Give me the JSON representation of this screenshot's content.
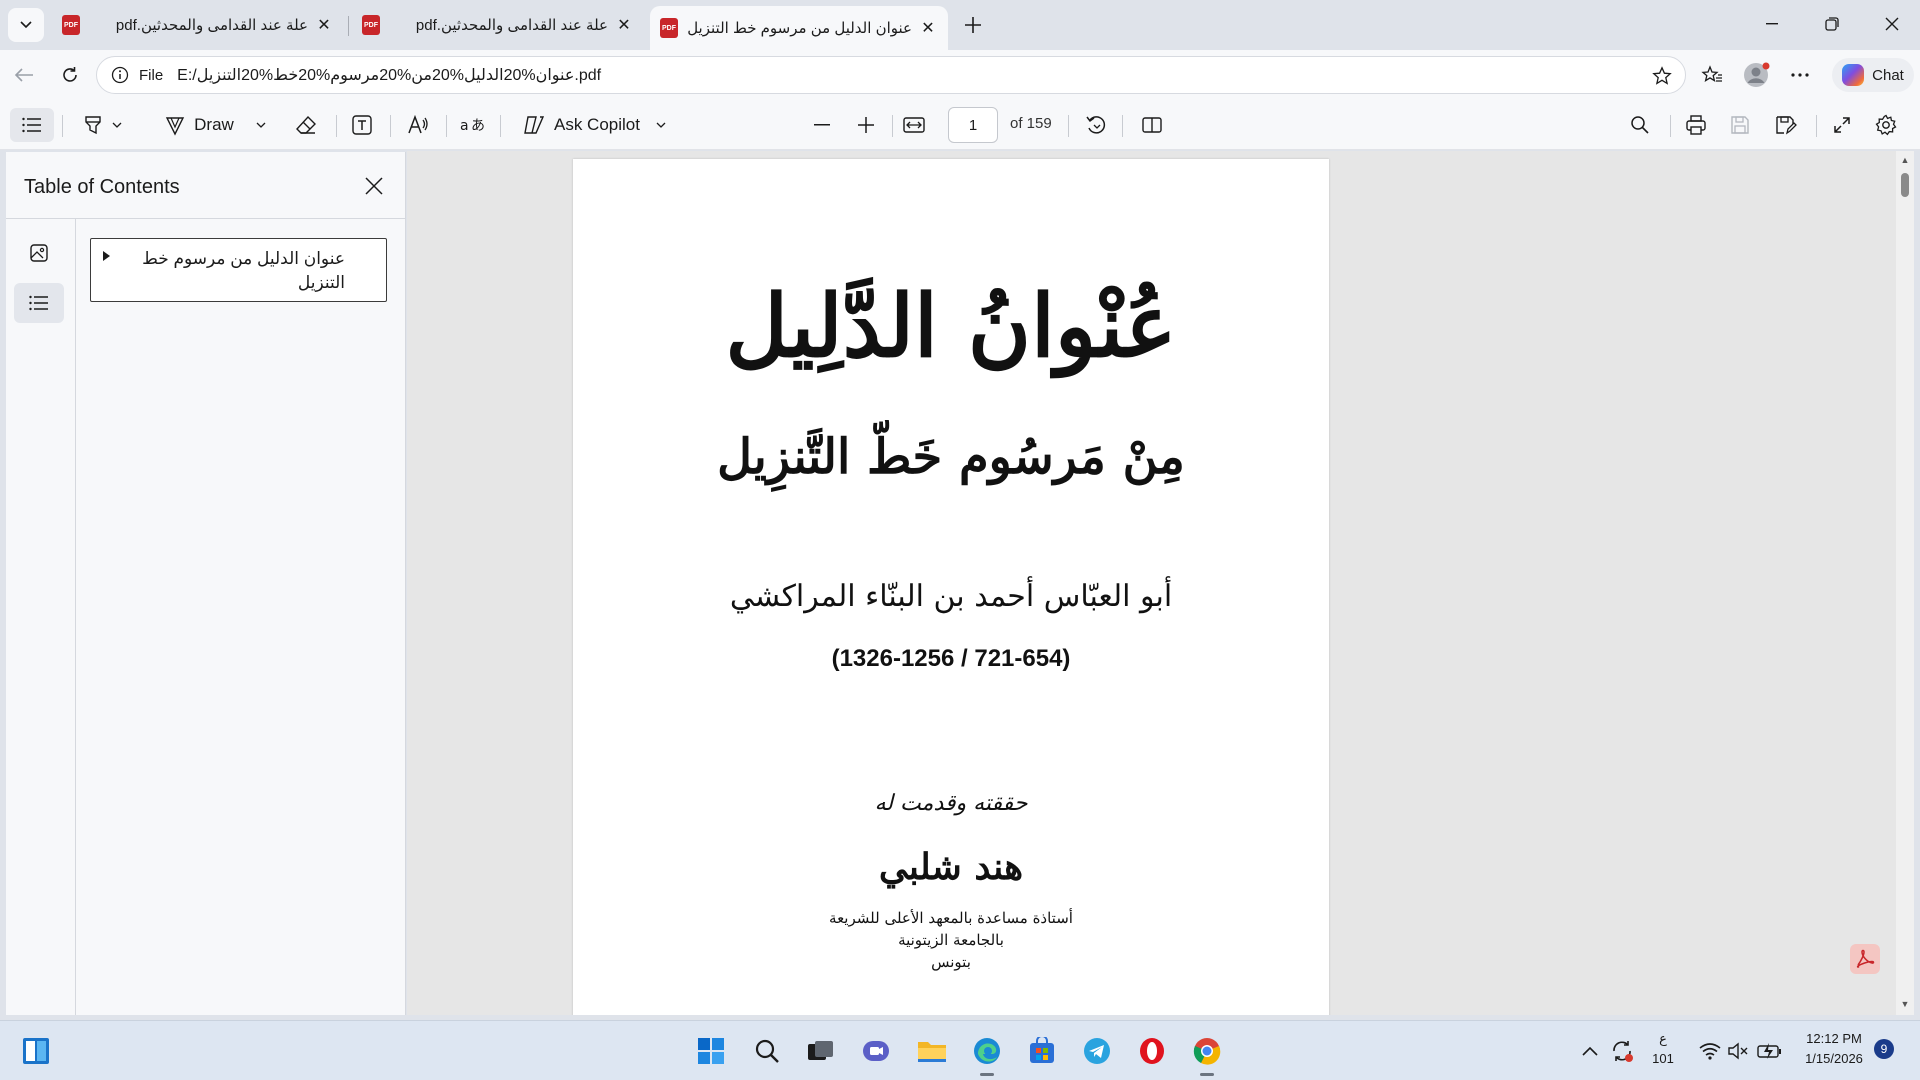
{
  "tabs": [
    {
      "label": "علة عند القدامى والمحدثين.pdf",
      "icon": "pdf-icon",
      "close": "✕",
      "active": false
    },
    {
      "label": "علة عند القدامى والمحدثين.pdf",
      "icon": "pdf-icon",
      "close": "✕",
      "active": false
    },
    {
      "label": "عنوان الدليل من مرسوم خط التنزيل.pdf",
      "icon": "pdf-icon",
      "close": "✕",
      "active": true
    }
  ],
  "pdf_badge": "PDF",
  "address": {
    "scheme": "File",
    "url": "E:/عنوان%20الدليل%20من%20مرسوم%20خط%20التنزيل.pdf"
  },
  "chat_label": "Chat",
  "pdf_toolbar": {
    "draw_label": "Draw",
    "copilot_label": "Ask Copilot",
    "page_number": "1",
    "page_count": "of 159"
  },
  "sidebar": {
    "title": "Table of Contents",
    "toc": [
      {
        "label": "عنوان الدليل من مرسوم خط التنزيل"
      }
    ]
  },
  "document": {
    "title_main": "عُنْوانُ الدَّلِيل",
    "title_sub": "مِنْ مَرسُوم خَطّ التَّنزِيل",
    "author": "أبو العبّاس أحمد بن البنّاء المراكشي",
    "dates": "(1326-1256 / 721-654)",
    "edited_by": "حققته وقدمت له",
    "editor_name": "هند شلبي",
    "affiliation": [
      "أستاذة مساعدة بالمعهد الأعلى للشريعة",
      "بالجامعة الزيتونية",
      "بتونس"
    ]
  },
  "taskbar": {
    "lang": "ع",
    "lang_code": "101",
    "time": "12:12 PM",
    "date": "1/15/2026",
    "notification_count": "9"
  },
  "colors": {
    "accent": "#0b57d0",
    "pdf_red": "#c8262a",
    "background": "#dfe3ea"
  }
}
